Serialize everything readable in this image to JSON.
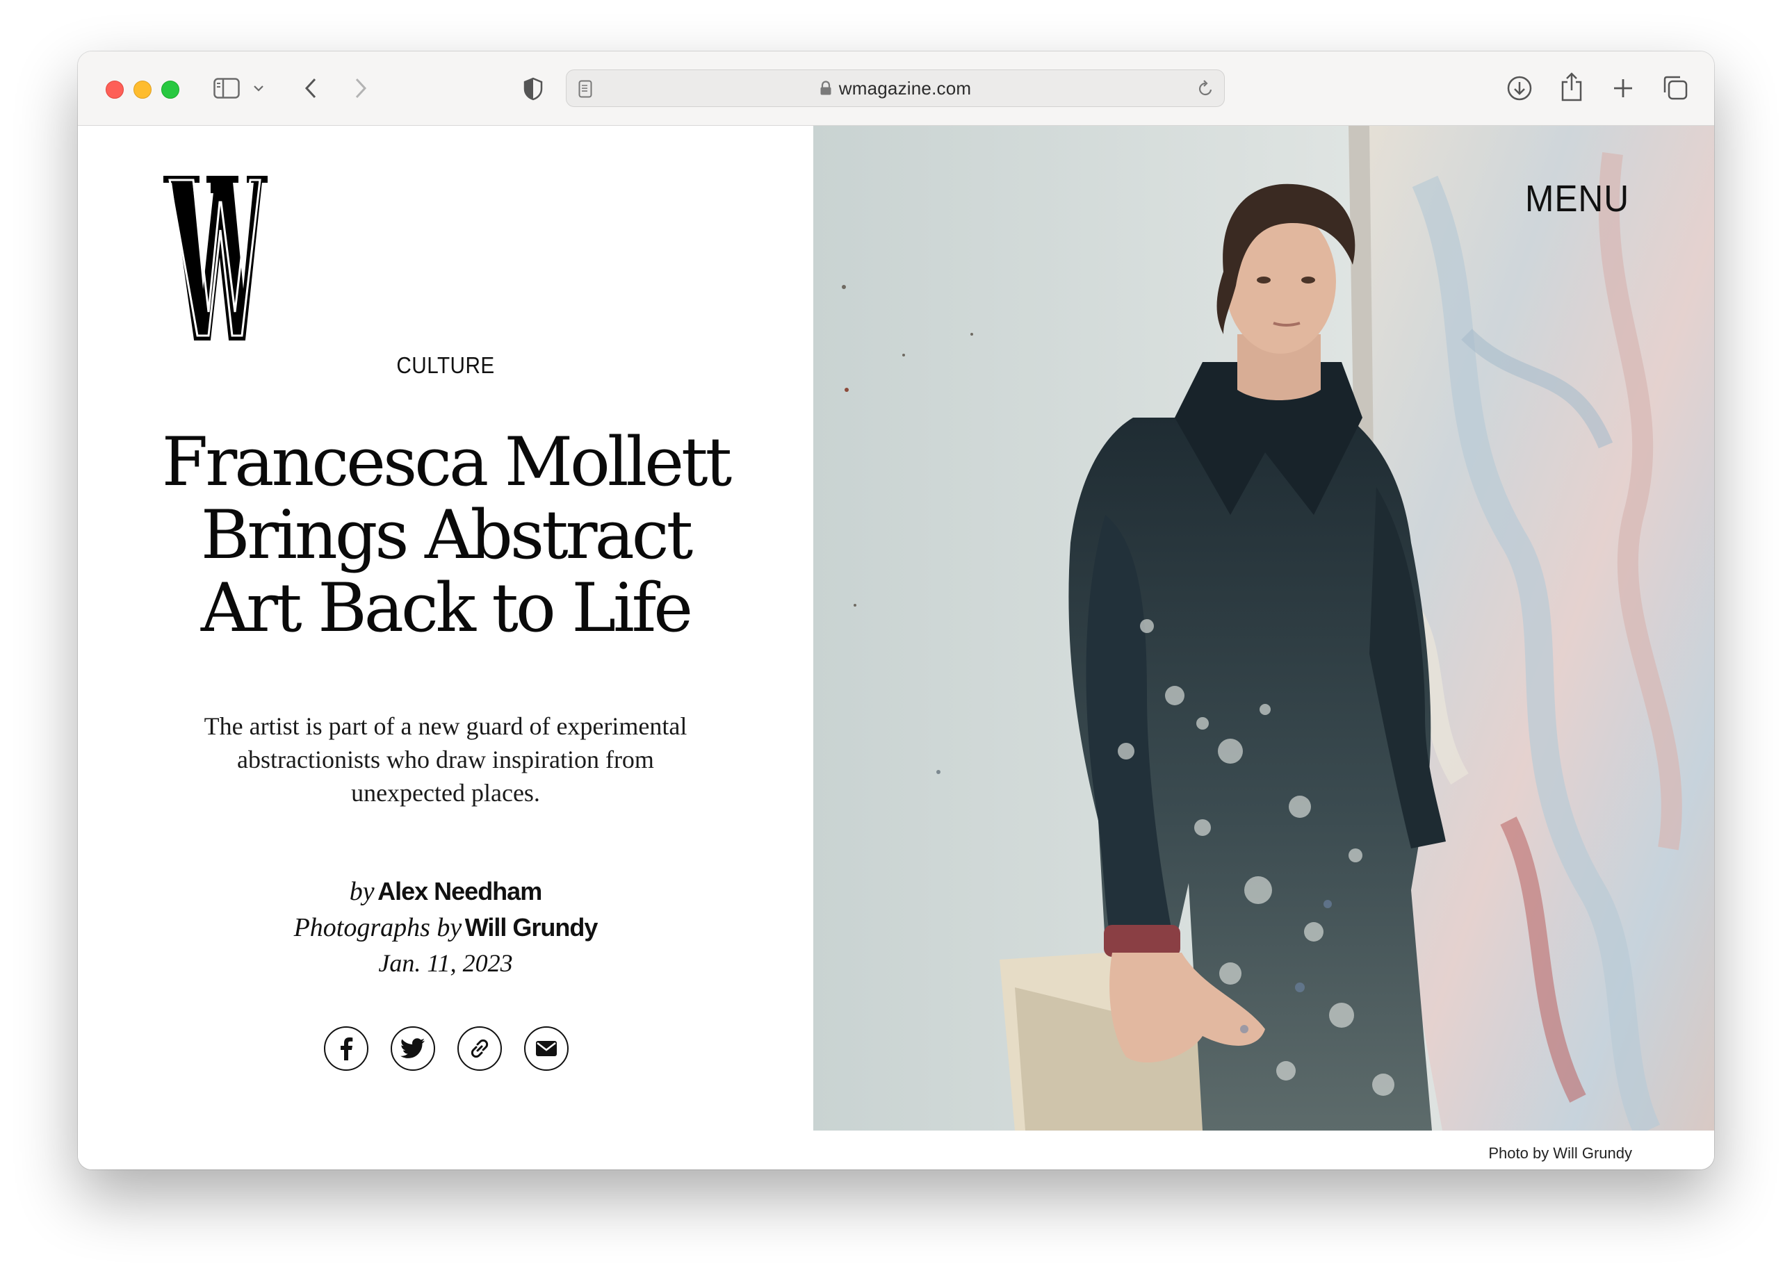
{
  "browser": {
    "url": "wmagazine.com"
  },
  "site": {
    "logo_letter": "W",
    "menu_label": "MENU"
  },
  "article": {
    "section": "CULTURE",
    "headline_lines": [
      "Francesca Mollett",
      "Brings Abstract",
      "Art Back to Life"
    ],
    "dek_lines": [
      "The artist is part of a new guard of experimental",
      "abstractionists who draw inspiration from",
      "unexpected places."
    ],
    "byline": {
      "by_prefix": "by",
      "author": "Alex Needham",
      "photos_prefix": "Photographs by",
      "photographer": "Will Grundy"
    },
    "date": "Jan. 11, 2023",
    "photo_credit": "Photo by Will Grundy"
  },
  "share": [
    "facebook",
    "twitter",
    "copy-link",
    "email"
  ],
  "colors": {
    "toolbar_bg": "#f6f5f4",
    "text": "#111111",
    "traffic_red": "#fe5f57",
    "traffic_yellow": "#febc2e",
    "traffic_green": "#28c840"
  }
}
